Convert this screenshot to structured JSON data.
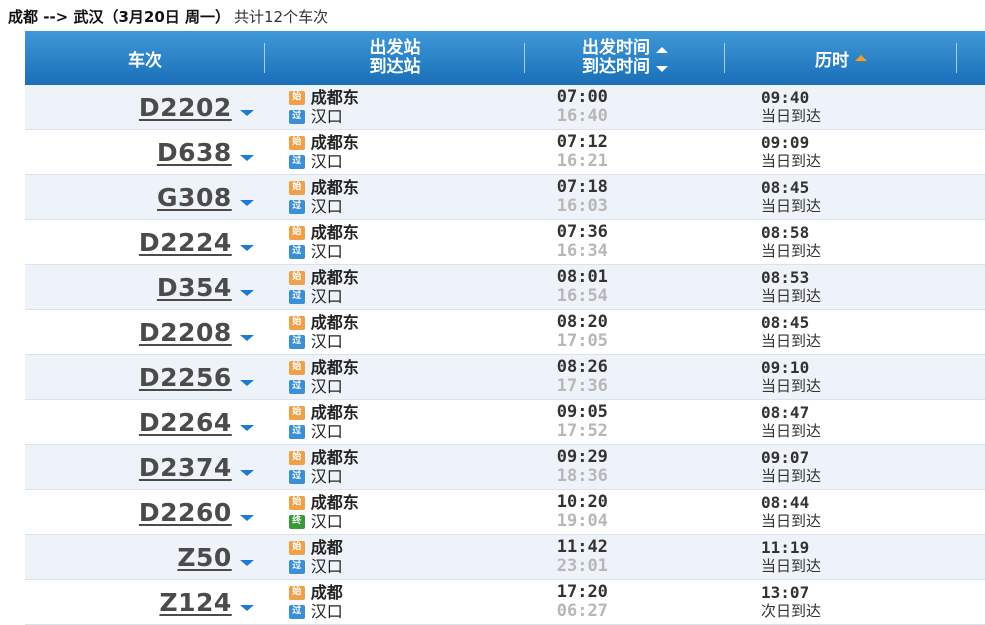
{
  "summary": {
    "route": "成都 --> 武汉（3月20日  周一）",
    "count": "共计12个车次"
  },
  "header": {
    "train": "车次",
    "station_dep": "出发站",
    "station_arr": "到达站",
    "time_dep": "出发时间",
    "time_arr": "到达时间",
    "duration": "历时"
  },
  "badges": {
    "start": "始",
    "pass": "过",
    "end": "终"
  },
  "colors": {
    "header_top": "#3f98d7",
    "header_bottom": "#1a6fb8",
    "sort_active": "#ff9c1a",
    "row_alt": "#eef3f9"
  },
  "rows": [
    {
      "train": "D2202",
      "from": "成都东",
      "to": "汉口",
      "to_badge": "pass",
      "dep": "07:00",
      "arr": "16:40",
      "dur": "09:40",
      "note": "当日到达"
    },
    {
      "train": "D638",
      "from": "成都东",
      "to": "汉口",
      "to_badge": "pass",
      "dep": "07:12",
      "arr": "16:21",
      "dur": "09:09",
      "note": "当日到达"
    },
    {
      "train": "G308",
      "from": "成都东",
      "to": "汉口",
      "to_badge": "pass",
      "dep": "07:18",
      "arr": "16:03",
      "dur": "08:45",
      "note": "当日到达"
    },
    {
      "train": "D2224",
      "from": "成都东",
      "to": "汉口",
      "to_badge": "pass",
      "dep": "07:36",
      "arr": "16:34",
      "dur": "08:58",
      "note": "当日到达"
    },
    {
      "train": "D354",
      "from": "成都东",
      "to": "汉口",
      "to_badge": "pass",
      "dep": "08:01",
      "arr": "16:54",
      "dur": "08:53",
      "note": "当日到达"
    },
    {
      "train": "D2208",
      "from": "成都东",
      "to": "汉口",
      "to_badge": "pass",
      "dep": "08:20",
      "arr": "17:05",
      "dur": "08:45",
      "note": "当日到达"
    },
    {
      "train": "D2256",
      "from": "成都东",
      "to": "汉口",
      "to_badge": "pass",
      "dep": "08:26",
      "arr": "17:36",
      "dur": "09:10",
      "note": "当日到达"
    },
    {
      "train": "D2264",
      "from": "成都东",
      "to": "汉口",
      "to_badge": "pass",
      "dep": "09:05",
      "arr": "17:52",
      "dur": "08:47",
      "note": "当日到达"
    },
    {
      "train": "D2374",
      "from": "成都东",
      "to": "汉口",
      "to_badge": "pass",
      "dep": "09:29",
      "arr": "18:36",
      "dur": "09:07",
      "note": "当日到达"
    },
    {
      "train": "D2260",
      "from": "成都东",
      "to": "汉口",
      "to_badge": "end",
      "dep": "10:20",
      "arr": "19:04",
      "dur": "08:44",
      "note": "当日到达"
    },
    {
      "train": "Z50",
      "from": "成都",
      "to": "汉口",
      "to_badge": "pass",
      "dep": "11:42",
      "arr": "23:01",
      "dur": "11:19",
      "note": "当日到达"
    },
    {
      "train": "Z124",
      "from": "成都",
      "to": "汉口",
      "to_badge": "pass",
      "dep": "17:20",
      "arr": "06:27",
      "dur": "13:07",
      "note": "次日到达"
    }
  ]
}
